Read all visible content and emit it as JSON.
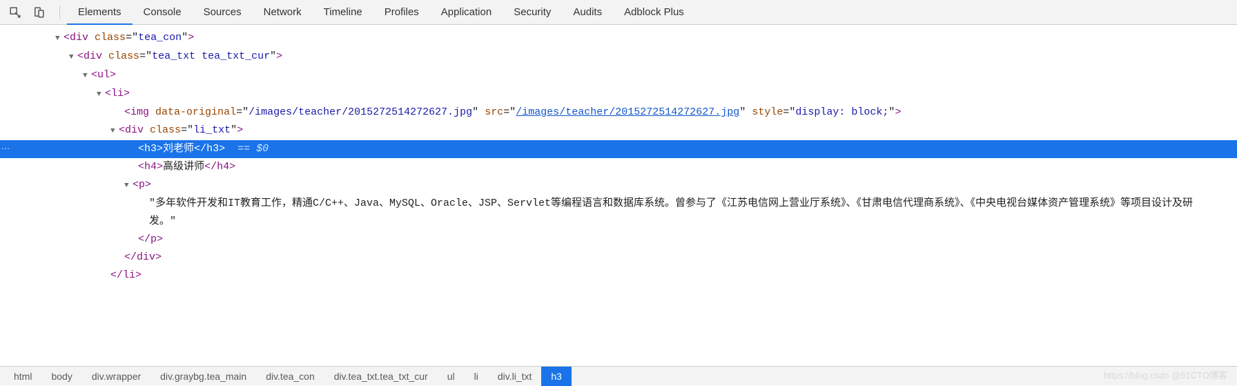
{
  "toolbar": {
    "tabs": [
      "Elements",
      "Console",
      "Sources",
      "Network",
      "Timeline",
      "Profiles",
      "Application",
      "Security",
      "Audits",
      "Adblock Plus"
    ],
    "active_tab": "Elements"
  },
  "tree": {
    "div_tea_con": {
      "tag": "div",
      "class": "tea_con"
    },
    "div_tea_txt": {
      "tag": "div",
      "class": "tea_txt tea_txt_cur"
    },
    "ul": {
      "tag": "ul"
    },
    "li": {
      "tag": "li"
    },
    "img": {
      "tag": "img",
      "data_original": "/images/teacher/2015272514272627.jpg",
      "src": "/images/teacher/2015272514272627.jpg",
      "style": "display: block;"
    },
    "div_li_txt": {
      "tag": "div",
      "class": "li_txt"
    },
    "h3": {
      "tag": "h3",
      "text": "刘老师",
      "selected_suffix": "== $0"
    },
    "h4": {
      "tag": "h4",
      "text": "高级讲师"
    },
    "p": {
      "tag": "p",
      "text": "\"多年软件开发和IT教育工作，精通C/C++、Java、MySQL、Oracle、JSP、Servlet等编程语言和数据库系统。曾参与了《江苏电信网上营业厅系统》、《甘肃电信代理商系统》、《中央电视台媒体资产管理系统》等项目设计及研发。\""
    },
    "close_p": "</p>",
    "close_div": "</div>",
    "close_li": "</li>"
  },
  "breadcrumbs": [
    "html",
    "body",
    "div.wrapper",
    "div.graybg.tea_main",
    "div.tea_con",
    "div.tea_txt.tea_txt_cur",
    "ul",
    "li",
    "div.li_txt",
    "h3"
  ],
  "watermark": "https://blog.csdn  @51CTO博客"
}
